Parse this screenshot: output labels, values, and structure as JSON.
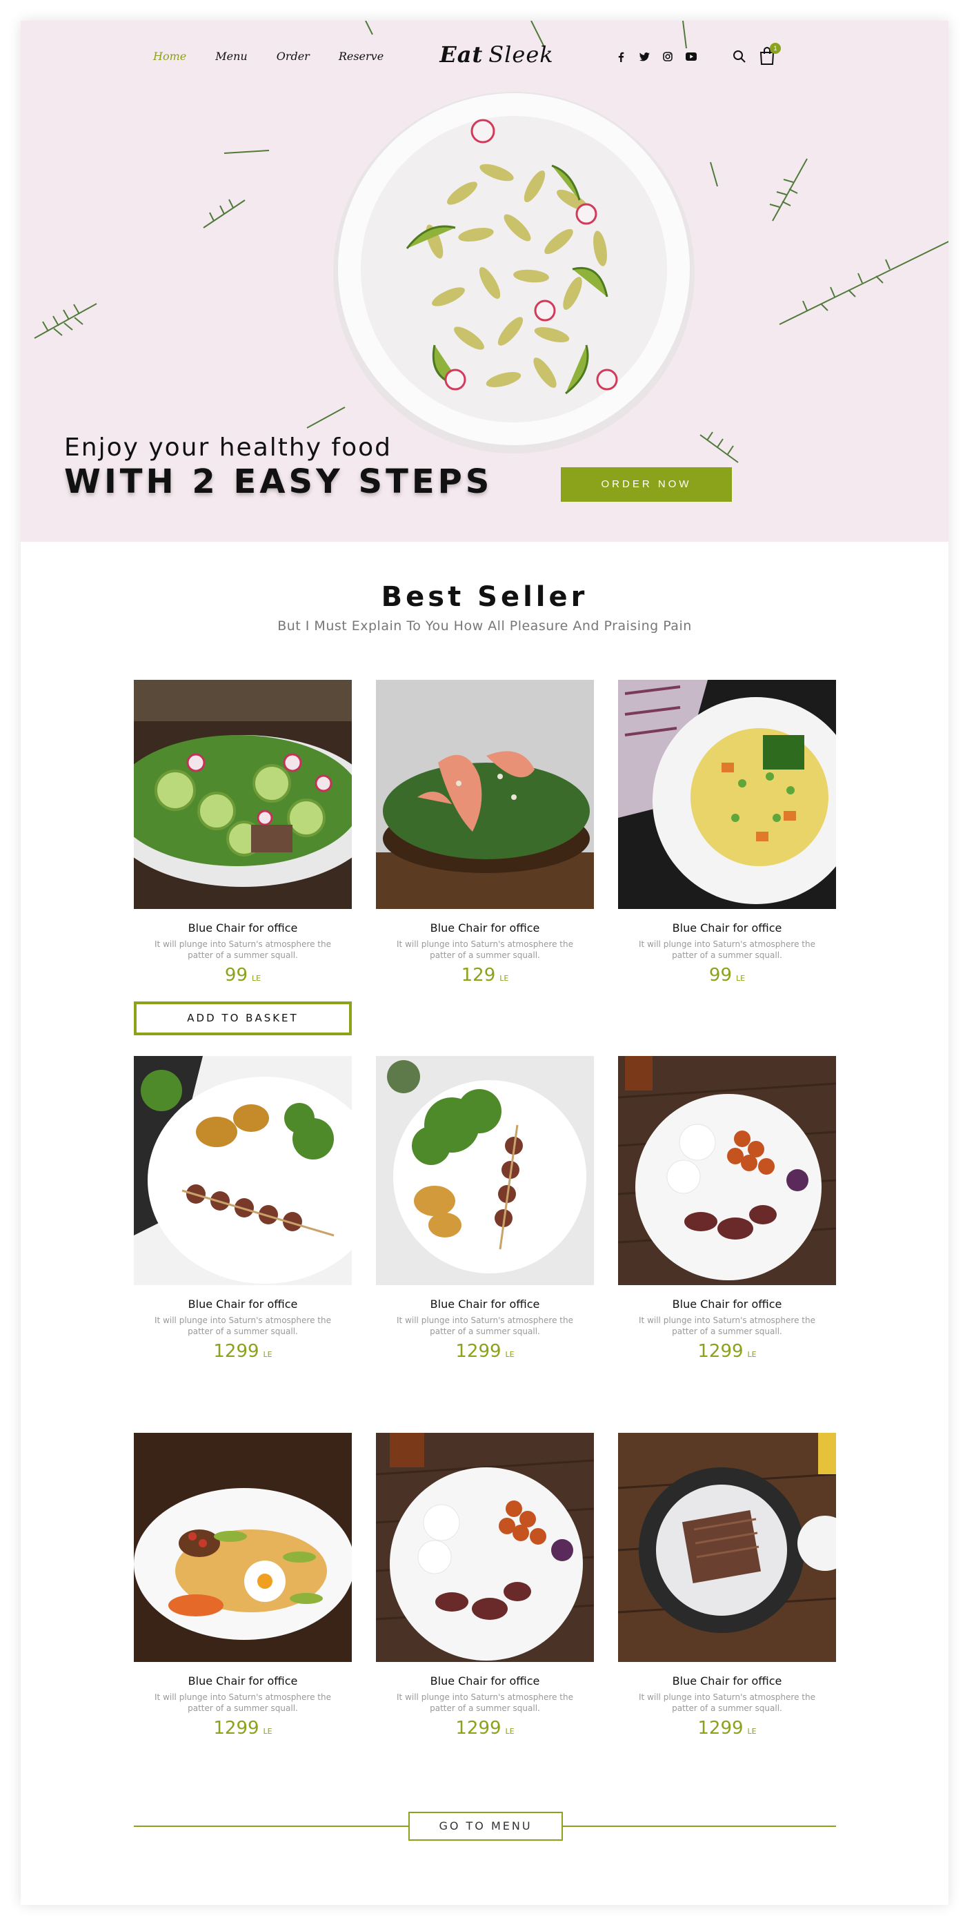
{
  "header": {
    "nav": [
      {
        "label": "Home",
        "active": true
      },
      {
        "label": "Menu",
        "active": false
      },
      {
        "label": "Order",
        "active": false
      },
      {
        "label": "Reserve",
        "active": false
      }
    ],
    "logo_part1": "Eat",
    "logo_part2": "Sleek",
    "socials": [
      "facebook-icon",
      "twitter-icon",
      "instagram-icon",
      "youtube-icon"
    ],
    "cart_count": "1"
  },
  "hero": {
    "line1": "Enjoy your healthy food",
    "line2": "WITH 2 EASY STEPS",
    "cta": "ORDER NOW"
  },
  "best_seller": {
    "title": "Best Seller",
    "subtitle": "But I Must Explain To You How All Pleasure And Praising Pain",
    "add_to_basket": "ADD TO BASKET",
    "products": [
      {
        "name": "Blue Chair for office",
        "desc": "It will plunge into Saturn's atmosphere the patter of a summer squall.",
        "price": "99",
        "currency": "LE"
      },
      {
        "name": "Blue Chair for office",
        "desc": "It will plunge into Saturn's atmosphere the patter of a summer squall.",
        "price": "129",
        "currency": "LE"
      },
      {
        "name": "Blue Chair for office",
        "desc": "It will plunge into Saturn's atmosphere the patter of a summer squall.",
        "price": "99",
        "currency": "LE"
      },
      {
        "name": "Blue Chair for office",
        "desc": "It will plunge into Saturn's atmosphere the patter of a summer squall.",
        "price": "1299",
        "currency": "LE"
      },
      {
        "name": "Blue Chair for office",
        "desc": "It will plunge into Saturn's atmosphere the patter of a summer squall.",
        "price": "1299",
        "currency": "LE"
      },
      {
        "name": "Blue Chair for office",
        "desc": "It will plunge into Saturn's atmosphere the patter of a summer squall.",
        "price": "1299",
        "currency": "LE"
      },
      {
        "name": "Blue Chair for office",
        "desc": "It will plunge into Saturn's atmosphere the patter of a summer squall.",
        "price": "1299",
        "currency": "LE"
      },
      {
        "name": "Blue Chair for office",
        "desc": "It will plunge into Saturn's atmosphere the patter of a summer squall.",
        "price": "1299",
        "currency": "LE"
      },
      {
        "name": "Blue Chair for office",
        "desc": "It will plunge into Saturn's atmosphere the patter of a summer squall.",
        "price": "1299",
        "currency": "LE"
      }
    ],
    "go_to_menu": "GO TO MENU"
  },
  "colors": {
    "accent": "#8aa31a",
    "hero_bg": "#f4e9ee",
    "text": "#111111",
    "muted": "#999999"
  }
}
